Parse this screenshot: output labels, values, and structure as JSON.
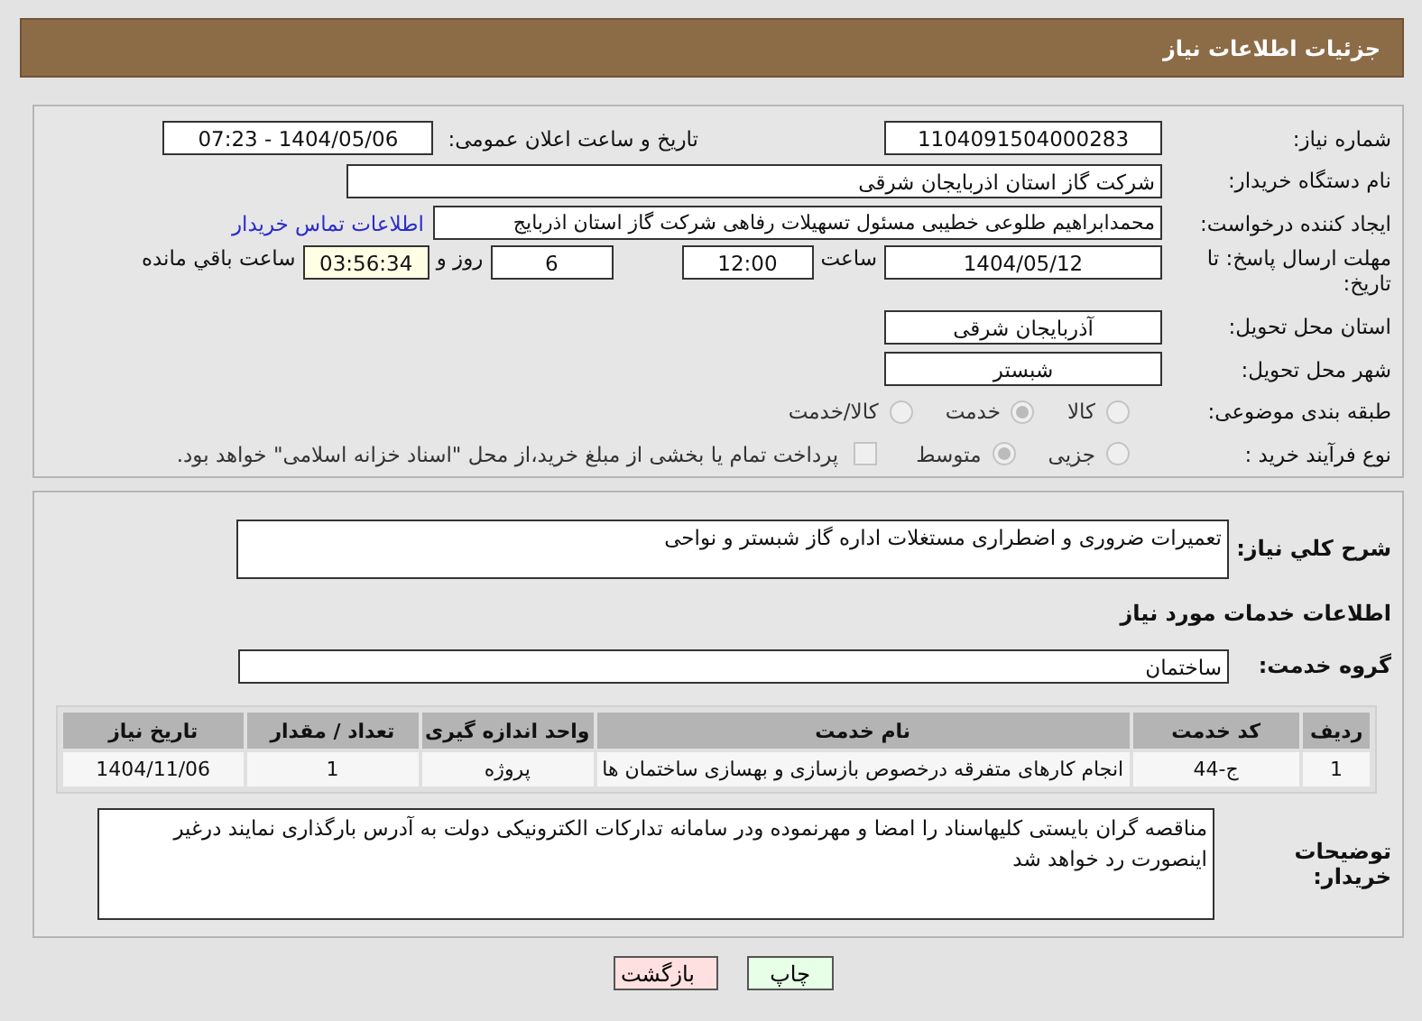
{
  "page_title": "جزئیات اطلاعات نیاز",
  "need_number": {
    "label": "شماره نیاز:",
    "value": "1104091504000283"
  },
  "announce_datetime": {
    "label": "تاریخ و ساعت اعلان عمومی:",
    "value": "1404/05/06 - 07:23"
  },
  "buyer_org": {
    "label": "نام دستگاه خریدار:",
    "value": "شرکت گاز استان اذربایجان شرقی"
  },
  "requester": {
    "label": "ایجاد کننده درخواست:",
    "value": "محمدابراهیم طلوعی خطیبی مسئول تسهیلات رفاهی  شرکت گاز استان اذربایج",
    "link": "اطلاعات تماس خریدار"
  },
  "deadline": {
    "label": "مهلت ارسال پاسخ: تا تاریخ:",
    "date": "1404/05/12",
    "time_label": "ساعت",
    "time": "12:00",
    "days": "6",
    "days_label": "روز و",
    "remaining": "03:56:34",
    "remaining_label": "ساعت باقي مانده"
  },
  "province": {
    "label": "استان محل تحویل:",
    "value": "آذربایجان شرقی"
  },
  "city": {
    "label": "شهر محل تحویل:",
    "value": "شبستر"
  },
  "category": {
    "label": "طبقه بندی موضوعی:",
    "options": [
      {
        "label": "کالا",
        "selected": false
      },
      {
        "label": "خدمت",
        "selected": true
      },
      {
        "label": "کالا/خدمت",
        "selected": false
      }
    ]
  },
  "process_type": {
    "label": "نوع فرآیند خرید :",
    "options": [
      {
        "label": "جزیی",
        "selected": false
      },
      {
        "label": "متوسط",
        "selected": true
      }
    ],
    "payment_option": {
      "label": "پرداخت تمام یا بخشی از مبلغ خرید،از محل \"اسناد خزانه اسلامی\" خواهد بود.",
      "checked": false
    }
  },
  "description": {
    "label": "شرح کلي نیاز:",
    "value": "تعمیرات ضروری و اضطراری مستغلات اداره گاز شبستر و نواحی"
  },
  "services_heading": "اطلاعات خدمات مورد نیاز",
  "service_group": {
    "label": "گروه خدمت:",
    "value": "ساختمان"
  },
  "table": {
    "columns": [
      "ردیف",
      "کد خدمت",
      "نام خدمت",
      "واحد اندازه گیری",
      "تعداد / مقدار",
      "تاریخ نیاز"
    ],
    "rows": [
      [
        "1",
        "ج-44",
        "انجام کارهای متفرقه درخصوص بازسازی و بهسازی ساختمان ها",
        "پروژه",
        "1",
        "1404/11/06"
      ]
    ]
  },
  "buyer_notes": {
    "label": "توضیحات خریدار:",
    "value": "مناقصه گران بایستی کلیهاسناد را امضا و مهرنموده ودر سامانه تدارکات الکترونیکی دولت به آدرس بارگذاری نمایند درغیر اینصورت رد خواهد شد"
  },
  "buttons": [
    {
      "label": "چاپ",
      "kind": "print"
    },
    {
      "label": "بازگشت",
      "kind": "back"
    }
  ]
}
